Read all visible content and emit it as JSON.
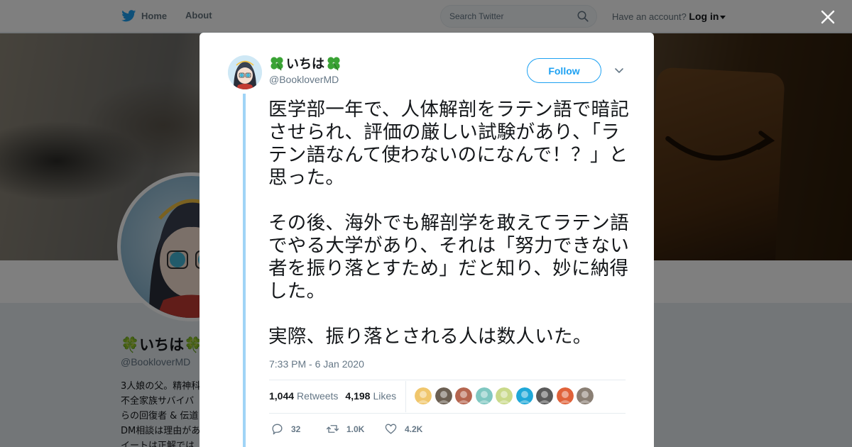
{
  "nav": {
    "home_label": "Home",
    "about_label": "About",
    "search_placeholder": "Search Twitter",
    "account_prompt": "Have an account?",
    "login_label": "Log in"
  },
  "background_profile": {
    "name": "🍀いちは🍀",
    "handle": "@BookloverMD",
    "bio_lines": [
      "3人娘の父。精神科",
      "不全家族サバイバ",
      "らの回復者 & 伝道",
      "DM相談は理由があ",
      "イートは正解では"
    ]
  },
  "tweet": {
    "display_name": "いちは",
    "handle": "@BookloverMD",
    "follow_label": "Follow",
    "text": "医学部一年で、人体解剖をラテン語で暗記させられ、評価の厳しい試験があり、「ラテン語なんて使わないのになんで！？」と思った。\n\nその後、海外でも解剖学を敢えてラテン語でやる大学があり、それは「努力できない者を振り落とすため」だと知り、妙に納得した。\n\n実際、振り落とされる人は数人いた。",
    "timestamp": "7:33 PM - 6 Jan 2020",
    "retweets_count": "1,044",
    "retweets_label": "Retweets",
    "likes_count": "4,198",
    "likes_label": "Likes",
    "reply_count": "32",
    "retweet_action_count": "1.0K",
    "like_action_count": "4.2K"
  },
  "colors": {
    "twitter_blue": "#1da1f2",
    "thread_line": "#a0d4f6",
    "text_secondary": "#657786",
    "clover_green": "#3aa335"
  },
  "likers": [
    {
      "name": "liker-1",
      "color": "#f0c66c"
    },
    {
      "name": "liker-2",
      "color": "#6b5f52"
    },
    {
      "name": "liker-3",
      "color": "#b5654f"
    },
    {
      "name": "liker-4",
      "color": "#7fc7c1"
    },
    {
      "name": "liker-5",
      "color": "#c9d98a"
    },
    {
      "name": "liker-6",
      "color": "#1fa8d8"
    },
    {
      "name": "liker-7",
      "color": "#5a5a5a"
    },
    {
      "name": "liker-8",
      "color": "#e0623a"
    },
    {
      "name": "liker-9",
      "color": "#8a7f74"
    }
  ]
}
